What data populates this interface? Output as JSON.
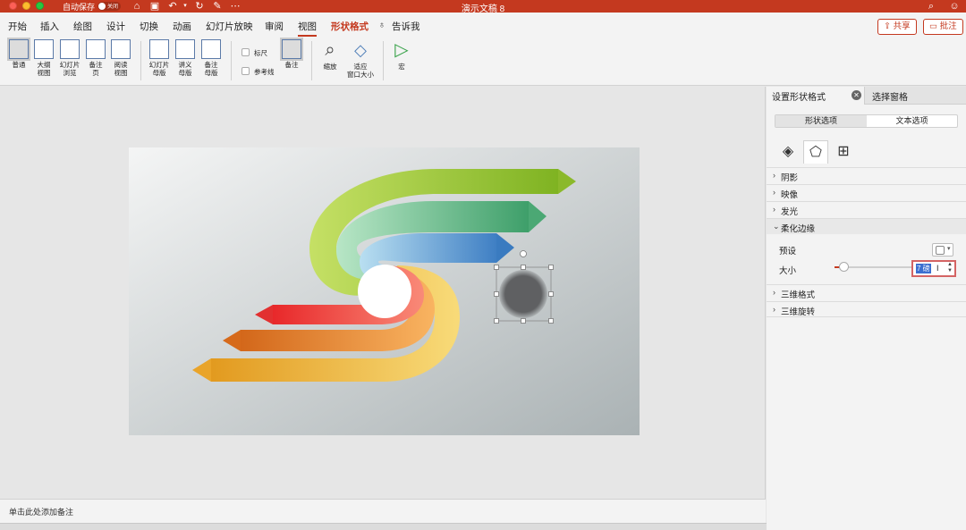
{
  "titlebar": {
    "autosave_label": "自动保存",
    "toggle_label": "关闭",
    "doc_title": "演示文稿 8"
  },
  "menu": {
    "items": [
      "开始",
      "插入",
      "绘图",
      "设计",
      "切换",
      "动画",
      "幻灯片放映",
      "审阅",
      "视图",
      "形状格式"
    ],
    "tell_me": "告诉我",
    "share": "共享",
    "comments": "批注"
  },
  "ribbon": {
    "normal": "普通",
    "outline": [
      "大纲",
      "视图"
    ],
    "sorter": [
      "幻灯片",
      "浏览"
    ],
    "notes_page": [
      "备注",
      "页"
    ],
    "reading": [
      "阅读",
      "视图"
    ],
    "slide_master": [
      "幻灯片",
      "母版"
    ],
    "handout_master": [
      "讲义",
      "母版"
    ],
    "notes_master": [
      "备注",
      "母版"
    ],
    "ruler": "标尺",
    "guides": "参考线",
    "notes": "备注",
    "zoom": "缩放",
    "fit_window": [
      "适应",
      "窗口大小"
    ],
    "macros": "宏"
  },
  "notes_placeholder": "单击此处添加备注",
  "pane": {
    "tab_format": "设置形状格式",
    "tab_selection": "选择窗格",
    "seg_shape": "形状选项",
    "seg_text": "文本选项",
    "sections": [
      "阴影",
      "映像",
      "发光",
      "柔化边缘",
      "三维格式",
      "三维旋转"
    ],
    "preset_label": "预设",
    "size_label": "大小",
    "size_value": "7 磅",
    "size_percent": 0.1
  },
  "colors": {
    "accent": "#c4391f",
    "green": "#8dc63f",
    "teal": "#6cc39a",
    "blue": "#4f8fd0",
    "red": "#ee4036",
    "orange": "#f39c3d",
    "yellow": "#f6c45a",
    "circle": "#5f6062"
  }
}
